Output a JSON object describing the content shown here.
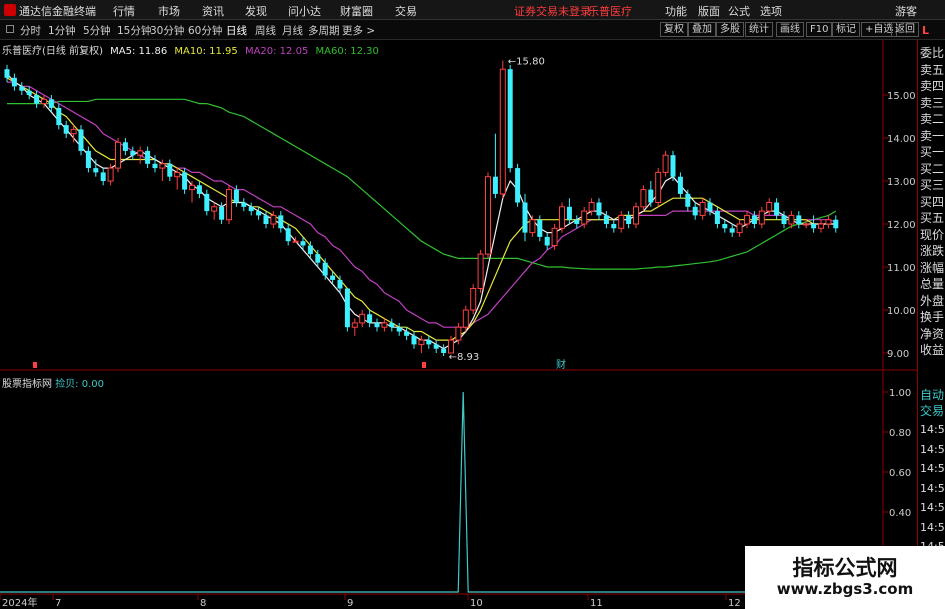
{
  "menu": {
    "app_name": "通达信金融终端",
    "items": [
      "行情",
      "市场",
      "资讯",
      "发现",
      "问小达",
      "财富圈",
      "交易"
    ],
    "notice": "证券交易未登录",
    "stock": "乐普医疗",
    "right_items": [
      "功能",
      "版面",
      "公式",
      "选项"
    ],
    "user": "游客"
  },
  "periods": [
    "分时",
    "1分钟",
    "5分钟",
    "15分钟",
    "30分钟",
    "60分钟",
    "日线",
    "周线",
    "月线",
    "多周期",
    "更多 >"
  ],
  "active_period": "日线",
  "toolbar": [
    "复权",
    "叠加",
    "多股",
    "统计",
    "画线",
    "F10",
    "标记",
    "+自选",
    "返回"
  ],
  "legend": {
    "title": "乐普医疗(日线 前复权)",
    "ma5": "MA5: 11.86",
    "ma10": "MA10: 11.95",
    "ma20": "MA20: 12.05",
    "ma60": "MA60: 12.30"
  },
  "price_axis": {
    "labels": [
      "15.00",
      "14.00",
      "13.00",
      "12.00",
      "11.00",
      "10.00",
      "9.00"
    ]
  },
  "annotations": {
    "high": "15.80",
    "low": "8.93",
    "fin": "财"
  },
  "indicator": {
    "name": "股票指标网",
    "param": "捡贝: 0.00",
    "axis": [
      "1.00",
      "0.80",
      "0.60",
      "0.40",
      "0.20"
    ]
  },
  "time_axis": [
    "2024年",
    "7",
    "8",
    "9",
    "10",
    "11",
    "12"
  ],
  "right_panel": {
    "labels": [
      "委比",
      "卖五",
      "卖四",
      "卖三",
      "卖二",
      "卖一",
      "买一",
      "买二",
      "买三",
      "买四",
      "买五",
      "现价",
      "涨跌",
      "涨幅",
      "总量",
      "外盘",
      "换手",
      "净资",
      "收益",
      "自动",
      "交易"
    ],
    "times": [
      "14:50",
      "14:50",
      "14:50",
      "14:50",
      "14:50",
      "14:50",
      "14:50",
      "14:50",
      "14:50"
    ],
    "corner": "L"
  },
  "watermark": {
    "line1": "指标公式网",
    "line2": "www.zbgs3.com"
  },
  "colors": {
    "up": "#ff4040",
    "down": "#3ef0ff",
    "ma5": "#f0f0f0",
    "ma10": "#e6e63c",
    "ma20": "#c040c0",
    "ma60": "#30c030",
    "frame": "#8b0000",
    "spike": "#40c8c8"
  },
  "chart_data": {
    "type": "candlestick",
    "ylim": [
      8.6,
      16.0
    ],
    "note": "daily OHLC, approx read from gridlines",
    "ohlc": [
      [
        15.6,
        15.7,
        15.3,
        15.4
      ],
      [
        15.4,
        15.5,
        15.1,
        15.2
      ],
      [
        15.2,
        15.3,
        15.0,
        15.1
      ],
      [
        15.1,
        15.2,
        14.9,
        15.0
      ],
      [
        15.0,
        15.1,
        14.7,
        14.8
      ],
      [
        14.8,
        15.0,
        14.7,
        14.9
      ],
      [
        14.9,
        15.0,
        14.6,
        14.7
      ],
      [
        14.7,
        14.8,
        14.2,
        14.3
      ],
      [
        14.3,
        14.4,
        14.0,
        14.1
      ],
      [
        14.1,
        14.3,
        13.9,
        14.2
      ],
      [
        14.2,
        14.3,
        13.6,
        13.7
      ],
      [
        13.7,
        13.8,
        13.2,
        13.3
      ],
      [
        13.3,
        13.5,
        13.1,
        13.2
      ],
      [
        13.2,
        13.3,
        12.9,
        13.0
      ],
      [
        13.0,
        13.4,
        12.9,
        13.3
      ],
      [
        13.3,
        14.0,
        13.2,
        13.9
      ],
      [
        13.9,
        14.0,
        13.6,
        13.7
      ],
      [
        13.7,
        13.8,
        13.5,
        13.6
      ],
      [
        13.6,
        13.8,
        13.4,
        13.7
      ],
      [
        13.7,
        13.8,
        13.3,
        13.4
      ],
      [
        13.4,
        13.6,
        13.2,
        13.3
      ],
      [
        13.3,
        13.5,
        13.0,
        13.4
      ],
      [
        13.4,
        13.5,
        13.0,
        13.1
      ],
      [
        13.1,
        13.3,
        12.8,
        13.2
      ],
      [
        13.2,
        13.3,
        12.7,
        12.8
      ],
      [
        12.8,
        13.0,
        12.5,
        12.9
      ],
      [
        12.9,
        13.0,
        12.6,
        12.7
      ],
      [
        12.7,
        12.8,
        12.2,
        12.3
      ],
      [
        12.3,
        12.5,
        12.1,
        12.4
      ],
      [
        12.4,
        12.5,
        12.0,
        12.1
      ],
      [
        12.1,
        12.9,
        12.0,
        12.8
      ],
      [
        12.8,
        12.9,
        12.4,
        12.5
      ],
      [
        12.5,
        12.6,
        12.3,
        12.4
      ],
      [
        12.4,
        12.5,
        12.2,
        12.3
      ],
      [
        12.3,
        12.4,
        12.1,
        12.2
      ],
      [
        12.2,
        12.3,
        11.9,
        12.0
      ],
      [
        12.0,
        12.3,
        11.9,
        12.2
      ],
      [
        12.2,
        12.3,
        11.8,
        11.9
      ],
      [
        11.9,
        12.0,
        11.5,
        11.6
      ],
      [
        11.6,
        11.7,
        11.6,
        11.6
      ],
      [
        11.6,
        11.7,
        11.4,
        11.5
      ],
      [
        11.5,
        11.6,
        11.2,
        11.3
      ],
      [
        11.3,
        11.4,
        11.0,
        11.1
      ],
      [
        11.1,
        11.2,
        10.7,
        10.8
      ],
      [
        10.8,
        10.9,
        10.6,
        10.7
      ],
      [
        10.7,
        10.8,
        10.4,
        10.5
      ],
      [
        10.5,
        10.5,
        9.5,
        9.6
      ],
      [
        9.6,
        9.8,
        9.4,
        9.7
      ],
      [
        9.7,
        10.0,
        9.6,
        9.9
      ],
      [
        9.9,
        10.0,
        9.6,
        9.7
      ],
      [
        9.7,
        9.8,
        9.5,
        9.6
      ],
      [
        9.6,
        9.8,
        9.5,
        9.7
      ],
      [
        9.7,
        9.8,
        9.5,
        9.6
      ],
      [
        9.6,
        9.7,
        9.4,
        9.5
      ],
      [
        9.5,
        9.6,
        9.3,
        9.4
      ],
      [
        9.4,
        9.5,
        9.1,
        9.2
      ],
      [
        9.2,
        9.4,
        9.0,
        9.3
      ],
      [
        9.3,
        9.4,
        9.1,
        9.2
      ],
      [
        9.2,
        9.3,
        9.0,
        9.1
      ],
      [
        9.1,
        9.2,
        8.93,
        9.0
      ],
      [
        9.0,
        9.4,
        9.0,
        9.3
      ],
      [
        9.3,
        9.7,
        9.2,
        9.6
      ],
      [
        9.6,
        10.1,
        9.5,
        10.0
      ],
      [
        10.0,
        10.6,
        9.9,
        10.5
      ],
      [
        10.5,
        11.4,
        10.4,
        11.3
      ],
      [
        11.3,
        13.2,
        11.2,
        13.1
      ],
      [
        13.1,
        14.1,
        12.6,
        12.7
      ],
      [
        12.7,
        15.8,
        12.6,
        15.6
      ],
      [
        15.6,
        15.7,
        13.2,
        13.3
      ],
      [
        13.3,
        13.4,
        12.4,
        12.5
      ],
      [
        12.5,
        12.7,
        11.6,
        11.8
      ],
      [
        11.8,
        12.2,
        11.7,
        12.1
      ],
      [
        12.1,
        12.2,
        11.6,
        11.7
      ],
      [
        11.7,
        11.8,
        11.4,
        11.5
      ],
      [
        11.5,
        12.0,
        11.4,
        11.9
      ],
      [
        11.9,
        12.5,
        11.8,
        12.4
      ],
      [
        12.4,
        12.6,
        12.0,
        12.1
      ],
      [
        12.1,
        12.2,
        11.9,
        12.0
      ],
      [
        12.0,
        12.4,
        11.9,
        12.3
      ],
      [
        12.3,
        12.6,
        12.2,
        12.5
      ],
      [
        12.5,
        12.6,
        12.1,
        12.2
      ],
      [
        12.2,
        12.3,
        11.9,
        12.0
      ],
      [
        12.0,
        12.1,
        11.8,
        11.9
      ],
      [
        11.9,
        12.3,
        11.8,
        12.2
      ],
      [
        12.2,
        12.3,
        11.9,
        12.0
      ],
      [
        12.0,
        12.5,
        11.9,
        12.4
      ],
      [
        12.4,
        12.9,
        12.3,
        12.8
      ],
      [
        12.8,
        13.0,
        12.4,
        12.5
      ],
      [
        12.5,
        13.3,
        12.4,
        13.2
      ],
      [
        13.2,
        13.7,
        13.1,
        13.6
      ],
      [
        13.6,
        13.7,
        13.0,
        13.1
      ],
      [
        13.1,
        13.2,
        12.6,
        12.7
      ],
      [
        12.7,
        12.8,
        12.3,
        12.4
      ],
      [
        12.4,
        12.5,
        12.1,
        12.2
      ],
      [
        12.2,
        12.6,
        12.1,
        12.5
      ],
      [
        12.5,
        12.6,
        12.2,
        12.3
      ],
      [
        12.3,
        12.4,
        11.9,
        12.0
      ],
      [
        12.0,
        12.1,
        11.8,
        11.9
      ],
      [
        11.9,
        12.0,
        11.7,
        11.8
      ],
      [
        11.8,
        12.1,
        11.7,
        12.0
      ],
      [
        12.0,
        12.3,
        11.9,
        12.2
      ],
      [
        12.2,
        12.3,
        11.9,
        12.0
      ],
      [
        12.0,
        12.4,
        11.9,
        12.3
      ],
      [
        12.3,
        12.6,
        12.2,
        12.5
      ],
      [
        12.5,
        12.6,
        12.1,
        12.2
      ],
      [
        12.2,
        12.3,
        11.9,
        12.0
      ],
      [
        12.0,
        12.3,
        11.9,
        12.2
      ],
      [
        12.2,
        12.3,
        11.9,
        12.0
      ],
      [
        12.0,
        12.1,
        11.9,
        12.0
      ],
      [
        12.0,
        12.2,
        11.8,
        11.9
      ],
      [
        11.9,
        12.1,
        11.8,
        12.0
      ],
      [
        12.0,
        12.2,
        11.9,
        12.1
      ],
      [
        12.1,
        12.2,
        11.8,
        11.9
      ]
    ],
    "ma5": [
      15.5,
      15.3,
      15.2,
      15.0,
      14.9,
      14.8,
      14.6,
      14.4,
      14.2,
      14.0,
      13.8,
      13.6,
      13.4,
      13.3,
      13.3,
      13.4,
      13.5,
      13.6,
      13.7,
      13.6,
      13.5,
      13.4,
      13.3,
      13.2,
      13.1,
      12.9,
      12.8,
      12.6,
      12.5,
      12.4,
      12.5,
      12.5,
      12.5,
      12.4,
      12.3,
      12.2,
      12.1,
      12.0,
      11.8,
      11.6,
      11.4,
      11.2,
      11.0,
      10.8,
      10.6,
      10.4,
      10.1,
      9.9,
      9.8,
      9.7,
      9.7,
      9.7,
      9.6,
      9.6,
      9.5,
      9.4,
      9.3,
      9.3,
      9.2,
      9.1,
      9.2,
      9.3,
      9.5,
      9.8,
      10.2,
      11.0,
      11.8,
      12.6,
      13.0,
      12.8,
      12.4,
      12.1,
      11.9,
      11.8,
      11.8,
      11.9,
      12.0,
      12.1,
      12.2,
      12.3,
      12.3,
      12.2,
      12.1,
      12.1,
      12.1,
      12.2,
      12.3,
      12.5,
      12.7,
      13.0,
      13.1,
      12.9,
      12.7,
      12.5,
      12.4,
      12.3,
      12.2,
      12.1,
      12.0,
      11.9,
      12.0,
      12.1,
      12.2,
      12.3,
      12.3,
      12.2,
      12.1,
      12.0,
      12.0,
      12.0,
      12.0,
      12.0,
      12.0
    ],
    "ma10": [
      15.4,
      15.3,
      15.2,
      15.1,
      15.0,
      14.9,
      14.8,
      14.6,
      14.5,
      14.3,
      14.1,
      13.9,
      13.7,
      13.6,
      13.5,
      13.5,
      13.5,
      13.5,
      13.5,
      13.5,
      13.5,
      13.4,
      13.4,
      13.3,
      13.2,
      13.1,
      13.0,
      12.9,
      12.8,
      12.7,
      12.6,
      12.5,
      12.5,
      12.4,
      12.4,
      12.3,
      12.2,
      12.1,
      12.0,
      11.9,
      11.7,
      11.5,
      11.3,
      11.1,
      10.9,
      10.7,
      10.5,
      10.3,
      10.2,
      10.0,
      9.9,
      9.8,
      9.7,
      9.6,
      9.6,
      9.5,
      9.5,
      9.4,
      9.3,
      9.3,
      9.3,
      9.4,
      9.5,
      9.7,
      10.0,
      10.4,
      10.8,
      11.2,
      11.6,
      11.8,
      12.0,
      12.1,
      12.1,
      12.1,
      12.1,
      12.1,
      12.1,
      12.1,
      12.1,
      12.1,
      12.1,
      12.1,
      12.1,
      12.2,
      12.2,
      12.2,
      12.3,
      12.3,
      12.4,
      12.5,
      12.6,
      12.6,
      12.6,
      12.6,
      12.6,
      12.5,
      12.4,
      12.3,
      12.2,
      12.1,
      12.1,
      12.1,
      12.1,
      12.1,
      12.1,
      12.1,
      12.1,
      12.1,
      12.1,
      12.0,
      12.0,
      12.0,
      12.0
    ],
    "ma20": [
      15.3,
      15.3,
      15.2,
      15.2,
      15.1,
      15.0,
      14.9,
      14.8,
      14.7,
      14.6,
      14.5,
      14.4,
      14.3,
      14.1,
      14.0,
      13.9,
      13.8,
      13.7,
      13.6,
      13.5,
      13.5,
      13.4,
      13.4,
      13.3,
      13.3,
      13.2,
      13.2,
      13.1,
      13.0,
      13.0,
      12.9,
      12.8,
      12.8,
      12.7,
      12.6,
      12.5,
      12.4,
      12.4,
      12.3,
      12.2,
      12.1,
      12.0,
      11.8,
      11.7,
      11.5,
      11.4,
      11.2,
      11.0,
      10.9,
      10.7,
      10.6,
      10.4,
      10.3,
      10.2,
      10.0,
      9.9,
      9.8,
      9.7,
      9.7,
      9.6,
      9.6,
      9.6,
      9.6,
      9.7,
      9.8,
      9.9,
      10.1,
      10.3,
      10.5,
      10.7,
      10.9,
      11.1,
      11.2,
      11.4,
      11.5,
      11.7,
      11.8,
      11.9,
      12.0,
      12.1,
      12.1,
      12.1,
      12.1,
      12.1,
      12.1,
      12.2,
      12.2,
      12.2,
      12.2,
      12.2,
      12.3,
      12.3,
      12.3,
      12.3,
      12.3,
      12.3,
      12.3,
      12.3,
      12.3,
      12.3,
      12.3,
      12.2,
      12.2,
      12.2,
      12.2,
      12.2,
      12.1,
      12.1,
      12.1,
      12.1,
      12.1,
      12.1,
      12.05
    ],
    "ma60": [
      14.8,
      14.8,
      14.8,
      14.8,
      14.8,
      14.8,
      14.8,
      14.85,
      14.85,
      14.85,
      14.85,
      14.85,
      14.9,
      14.9,
      14.9,
      14.9,
      14.9,
      14.9,
      14.9,
      14.9,
      14.9,
      14.9,
      14.9,
      14.9,
      14.9,
      14.85,
      14.8,
      14.8,
      14.75,
      14.7,
      14.6,
      14.55,
      14.5,
      14.4,
      14.3,
      14.2,
      14.1,
      14.0,
      13.9,
      13.8,
      13.7,
      13.6,
      13.5,
      13.4,
      13.3,
      13.2,
      13.1,
      12.95,
      12.8,
      12.65,
      12.5,
      12.35,
      12.2,
      12.05,
      11.9,
      11.75,
      11.6,
      11.5,
      11.4,
      11.3,
      11.25,
      11.2,
      11.2,
      11.2,
      11.2,
      11.2,
      11.2,
      11.2,
      11.2,
      11.2,
      11.15,
      11.1,
      11.05,
      11.0,
      11.0,
      11.0,
      10.98,
      10.97,
      10.96,
      10.95,
      10.95,
      10.95,
      10.95,
      10.95,
      10.95,
      10.95,
      10.97,
      10.98,
      11.0,
      11.0,
      11.02,
      11.04,
      11.06,
      11.08,
      11.1,
      11.12,
      11.15,
      11.2,
      11.25,
      11.3,
      11.35,
      11.45,
      11.55,
      11.65,
      11.75,
      11.85,
      11.95,
      12.0,
      12.05,
      12.1,
      12.15,
      12.2,
      12.3
    ],
    "indicator_values": {
      "spike_index": 63,
      "spike_value": 1.0
    }
  }
}
